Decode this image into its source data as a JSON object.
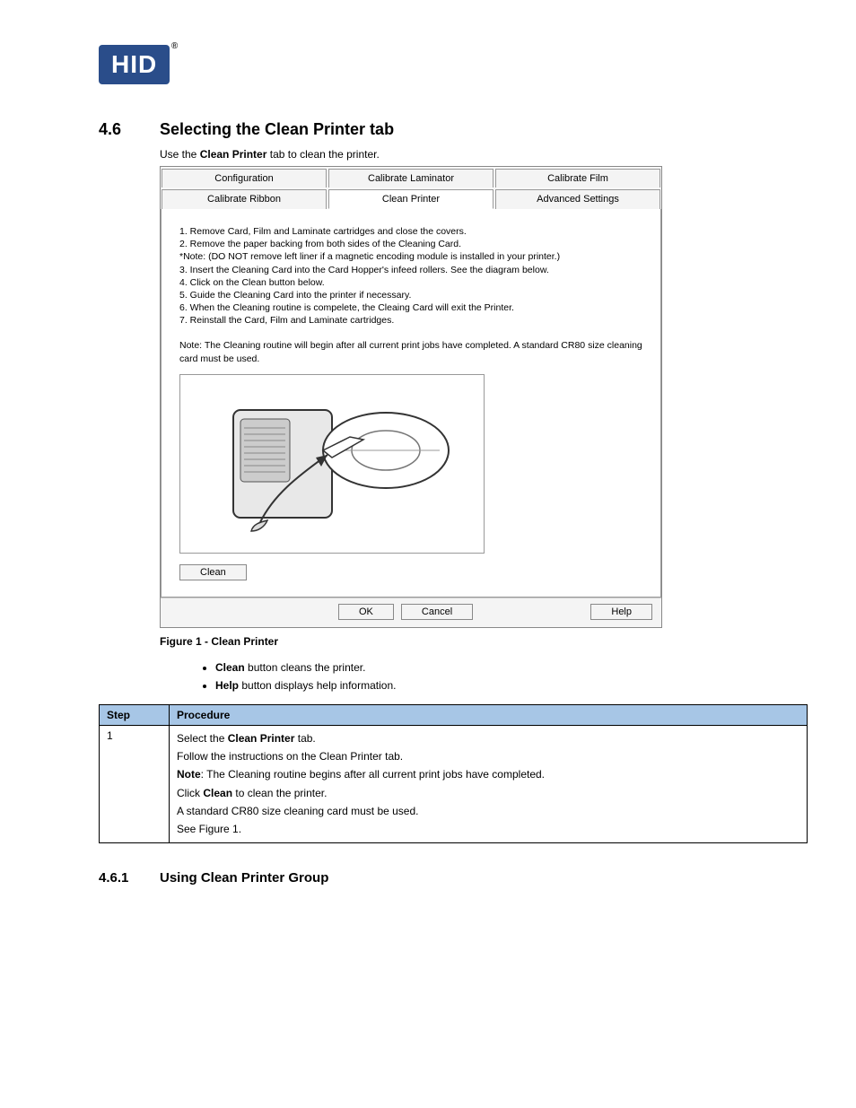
{
  "logo_text": "HID",
  "section": {
    "number": "4.6",
    "title": "Selecting the Clean Printer tab"
  },
  "intro": {
    "prefix": "Use the ",
    "bold": "Clean Printer",
    "suffix": " tab to clean the printer."
  },
  "dialog": {
    "tabs_row1": [
      "Configuration",
      "Calibrate Laminator",
      "Calibrate Film"
    ],
    "tabs_row2": [
      "Calibrate Ribbon",
      "Clean Printer",
      "Advanced Settings"
    ],
    "instructions": [
      "1. Remove Card, Film and Laminate cartridges and close the covers.",
      "2. Remove the paper backing from both sides of the Cleaning Card.",
      "*Note: (DO NOT remove left liner if a magnetic encoding module is installed in your printer.)",
      "3. Insert the Cleaning Card into the Card Hopper's infeed rollers. See the diagram below.",
      "4. Click on the Clean button below.",
      "5. Guide the Cleaning Card into the printer if necessary.",
      "6. When the Cleaning routine is compelete, the Cleaing Card will exit the Printer.",
      "7. Reinstall the Card, Film and Laminate cartridges."
    ],
    "note": "Note: The Cleaning routine will begin after all current print jobs have completed.  A standard CR80 size cleaning card must be used.",
    "clean_button": "Clean",
    "ok_button": "OK",
    "cancel_button": "Cancel",
    "help_button": "Help"
  },
  "figure_caption": "Figure 1 - Clean Printer",
  "bullets": {
    "clean": {
      "bold": "Clean",
      "rest": " button cleans the printer."
    },
    "help": {
      "bold": "Help",
      "rest": " button displays help information."
    }
  },
  "table": {
    "headers": {
      "step": "Step",
      "procedure": "Procedure"
    },
    "row": {
      "step": "1",
      "p1_prefix": "Select the ",
      "p1_bold": "Clean Printer",
      "p1_suffix": " tab.",
      "p2": "Follow the instructions on the Clean Printer tab.",
      "p3_bold": "Note",
      "p3_rest": ": The Cleaning routine begins after all current print jobs have completed.",
      "p4_prefix": "Click ",
      "p4_bold": "Clean",
      "p4_suffix": " to clean the printer.",
      "p5": "A standard CR80 size cleaning card must be used.",
      "p6": "See Figure 1."
    }
  },
  "subsection": {
    "number": "4.6.1",
    "title": "Using Clean Printer Group"
  }
}
